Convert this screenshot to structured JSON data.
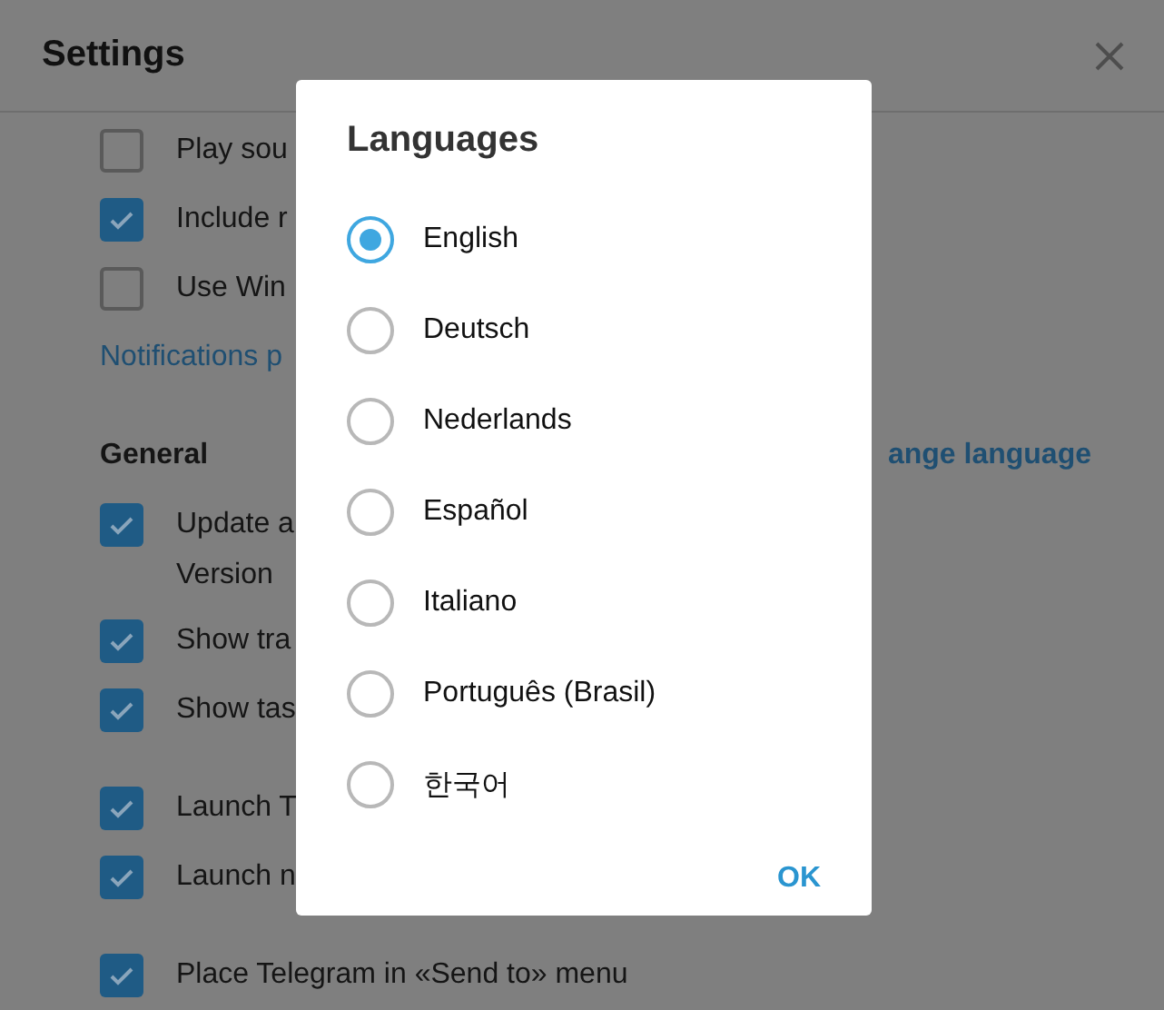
{
  "window": {
    "title": "Settings"
  },
  "groups": [
    {
      "rows": [
        {
          "kind": "checkbox",
          "label": "Play sou",
          "checked": false
        },
        {
          "kind": "checkbox",
          "label": "Include r",
          "checked": true
        },
        {
          "kind": "checkbox",
          "label": "Use Win",
          "checked": false
        },
        {
          "kind": "link",
          "label": "Notifications p"
        }
      ]
    },
    {
      "rows": [
        {
          "kind": "section",
          "label": "General",
          "link": "ange language"
        },
        {
          "kind": "checkbox",
          "label": "Update a",
          "checked": true
        },
        {
          "kind": "note",
          "label": "Version"
        },
        {
          "kind": "checkbox",
          "label": "Show tra",
          "checked": true
        },
        {
          "kind": "checkbox",
          "label": "Show tas",
          "checked": true
        }
      ]
    },
    {
      "rows": [
        {
          "kind": "checkbox",
          "label": "Launch T",
          "checked": true
        },
        {
          "kind": "checkbox",
          "label": "Launch n",
          "checked": true
        }
      ]
    },
    {
      "rows": [
        {
          "kind": "checkbox",
          "label": "Place Telegram in «Send to» menu",
          "checked": true
        }
      ]
    }
  ],
  "dialog": {
    "title": "Languages",
    "options": [
      {
        "label": "English",
        "selected": true
      },
      {
        "label": "Deutsch",
        "selected": false
      },
      {
        "label": "Nederlands",
        "selected": false
      },
      {
        "label": "Español",
        "selected": false
      },
      {
        "label": "Italiano",
        "selected": false
      },
      {
        "label": "Português (Brasil)",
        "selected": false
      },
      {
        "label": "한국어",
        "selected": false
      }
    ],
    "ok": "OK"
  }
}
